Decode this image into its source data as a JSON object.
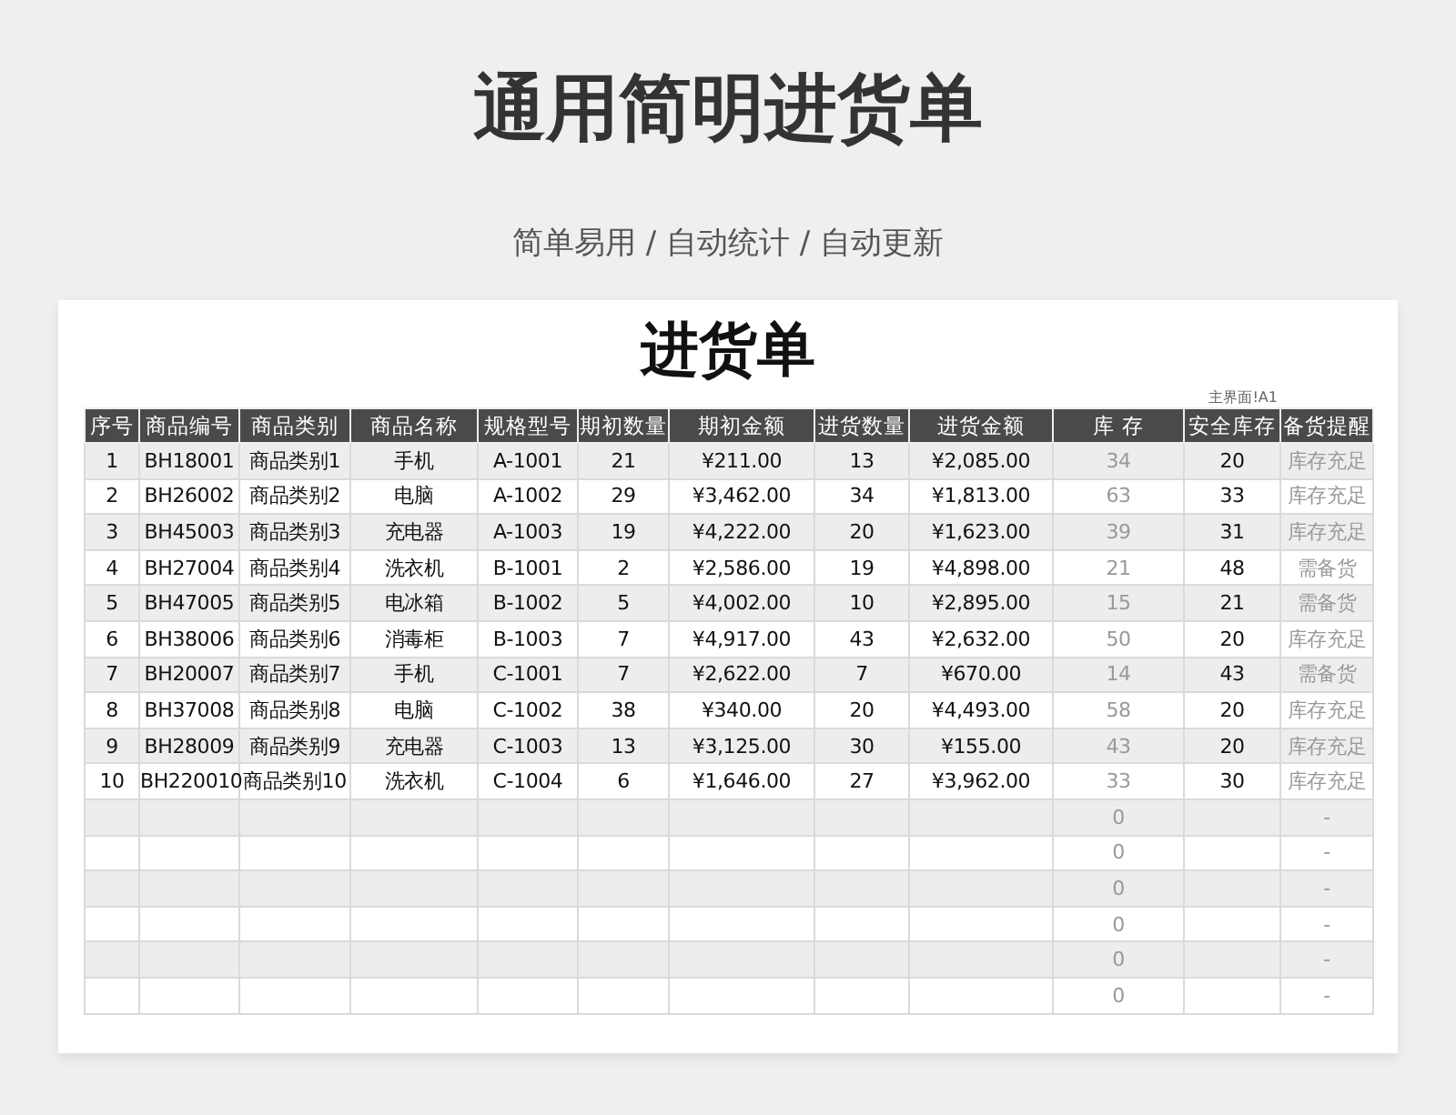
{
  "headline": "通用简明进货单",
  "subtitle": "简单易用 / 自动统计 / 自动更新",
  "sheet": {
    "title": "进货单",
    "note": "主界面!A1",
    "columns": [
      "序号",
      "商品编号",
      "商品类别",
      "商品名称",
      "规格型号",
      "期初数量",
      "期初金额",
      "进货数量",
      "进货金额",
      "库 存",
      "安全库存",
      "备货提醒"
    ],
    "rows": [
      {
        "kind": "item",
        "cells": [
          "1",
          "BH18001",
          "商品类别1",
          "手机",
          "A-1001",
          "21",
          "¥211.00",
          "13",
          "¥2,085.00",
          "34",
          "20",
          "库存充足"
        ]
      },
      {
        "kind": "item",
        "cells": [
          "2",
          "BH26002",
          "商品类别2",
          "电脑",
          "A-1002",
          "29",
          "¥3,462.00",
          "34",
          "¥1,813.00",
          "63",
          "33",
          "库存充足"
        ]
      },
      {
        "kind": "item",
        "cells": [
          "3",
          "BH45003",
          "商品类别3",
          "充电器",
          "A-1003",
          "19",
          "¥4,222.00",
          "20",
          "¥1,623.00",
          "39",
          "31",
          "库存充足"
        ]
      },
      {
        "kind": "item",
        "cells": [
          "4",
          "BH27004",
          "商品类别4",
          "洗衣机",
          "B-1001",
          "2",
          "¥2,586.00",
          "19",
          "¥4,898.00",
          "21",
          "48",
          "需备货"
        ]
      },
      {
        "kind": "item",
        "cells": [
          "5",
          "BH47005",
          "商品类别5",
          "电冰箱",
          "B-1002",
          "5",
          "¥4,002.00",
          "10",
          "¥2,895.00",
          "15",
          "21",
          "需备货"
        ]
      },
      {
        "kind": "item",
        "cells": [
          "6",
          "BH38006",
          "商品类别6",
          "消毒柜",
          "B-1003",
          "7",
          "¥4,917.00",
          "43",
          "¥2,632.00",
          "50",
          "20",
          "库存充足"
        ]
      },
      {
        "kind": "item",
        "cells": [
          "7",
          "BH20007",
          "商品类别7",
          "手机",
          "C-1001",
          "7",
          "¥2,622.00",
          "7",
          "¥670.00",
          "14",
          "43",
          "需备货"
        ]
      },
      {
        "kind": "item",
        "cells": [
          "8",
          "BH37008",
          "商品类别8",
          "电脑",
          "C-1002",
          "38",
          "¥340.00",
          "20",
          "¥4,493.00",
          "58",
          "20",
          "库存充足"
        ]
      },
      {
        "kind": "item",
        "cells": [
          "9",
          "BH28009",
          "商品类别9",
          "充电器",
          "C-1003",
          "13",
          "¥3,125.00",
          "30",
          "¥155.00",
          "43",
          "20",
          "库存充足"
        ]
      },
      {
        "kind": "item",
        "cells": [
          "10",
          "BH220010",
          "商品类别10",
          "洗衣机",
          "C-1004",
          "6",
          "¥1,646.00",
          "27",
          "¥3,962.00",
          "33",
          "30",
          "库存充足"
        ]
      },
      {
        "kind": "blank",
        "stock": "0",
        "reminder": "-"
      },
      {
        "kind": "blank",
        "stock": "0",
        "reminder": "-"
      },
      {
        "kind": "blank",
        "stock": "0",
        "reminder": "-"
      },
      {
        "kind": "blank",
        "stock": "0",
        "reminder": "-"
      },
      {
        "kind": "blank",
        "stock": "0",
        "reminder": "-"
      },
      {
        "kind": "blank",
        "stock": "0",
        "reminder": "-"
      }
    ]
  }
}
